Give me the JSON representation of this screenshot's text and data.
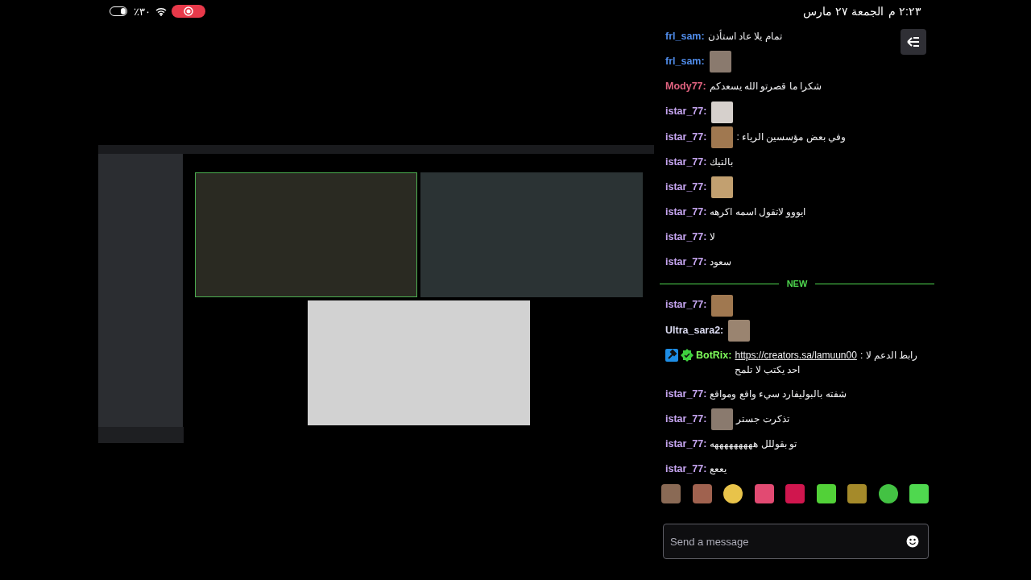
{
  "status_bar": {
    "battery": "٪٣٠",
    "recording": true,
    "time": "٢:٢٣ م",
    "date": "الجمعة ٢٧ مارس"
  },
  "chat": {
    "messages": [
      {
        "user": "frl_sam:",
        "color": "#4f8be8",
        "parts": [
          {
            "kind": "text",
            "text": "تمام يلا عاد استأذن"
          }
        ]
      },
      {
        "user": "frl_sam:",
        "color": "#4f8be8",
        "parts": [
          {
            "kind": "emote"
          }
        ]
      },
      {
        "user": "Mody77:",
        "color": "#e0627f",
        "parts": [
          {
            "kind": "text",
            "text": "شكرا ما قصرتو الله يسعدكم"
          }
        ]
      },
      {
        "user": "istar_77:",
        "color": "#c7a6f2",
        "parts": [
          {
            "kind": "emote"
          }
        ]
      },
      {
        "user": "istar_77:",
        "color": "#c7a6f2",
        "parts": [
          {
            "kind": "emote"
          },
          {
            "kind": "text",
            "text": "وفي بعض مؤسسين الرياء :"
          }
        ]
      },
      {
        "user": "istar_77:",
        "color": "#c7a6f2",
        "parts": [
          {
            "kind": "text",
            "text": "بالتيك"
          }
        ]
      },
      {
        "user": "istar_77:",
        "color": "#c7a6f2",
        "parts": [
          {
            "kind": "emote"
          }
        ]
      },
      {
        "user": "istar_77:",
        "color": "#c7a6f2",
        "parts": [
          {
            "kind": "text",
            "text": "ايووو لاتقول اسمه اكرهه"
          }
        ]
      },
      {
        "user": "istar_77:",
        "color": "#c7a6f2",
        "parts": [
          {
            "kind": "text",
            "text": "لا"
          }
        ]
      },
      {
        "user": "istar_77:",
        "color": "#c7a6f2",
        "parts": [
          {
            "kind": "text",
            "text": "سعود"
          }
        ]
      },
      {
        "kind": "divider",
        "label": "NEW"
      },
      {
        "user": "istar_77:",
        "color": "#c7a6f2",
        "parts": [
          {
            "kind": "emote"
          }
        ]
      },
      {
        "user": "Ultra_sara2:",
        "color": "#dcdcf2",
        "parts": [
          {
            "kind": "emote"
          }
        ]
      },
      {
        "user": "BotRix:",
        "color": "#7dfa5a",
        "badges": [
          {
            "kind": "hammer"
          },
          {
            "kind": "verified"
          }
        ],
        "parts": [
          {
            "kind": "text",
            "text": "رابط الدعم لا : احد يكتب لا تلمح"
          },
          {
            "kind": "link",
            "text": "https://creators.sa/lamuun00"
          }
        ]
      },
      {
        "user": "istar_77:",
        "color": "#c7a6f2",
        "parts": [
          {
            "kind": "text",
            "text": "شفته بالبوليفارد سيء واقع ومواقع"
          }
        ]
      },
      {
        "user": "istar_77:",
        "color": "#c7a6f2",
        "parts": [
          {
            "kind": "emote"
          },
          {
            "kind": "text",
            "text": "تذكرت جستر"
          }
        ]
      },
      {
        "user": "istar_77:",
        "color": "#c7a6f2",
        "parts": [
          {
            "kind": "text",
            "text": "تو بقوللل هههههههههه"
          }
        ]
      },
      {
        "user": "istar_77:",
        "color": "#c7a6f2",
        "parts": [
          {
            "kind": "text",
            "text": "يععع"
          }
        ]
      }
    ],
    "input": {
      "placeholder": "Send a message"
    }
  }
}
